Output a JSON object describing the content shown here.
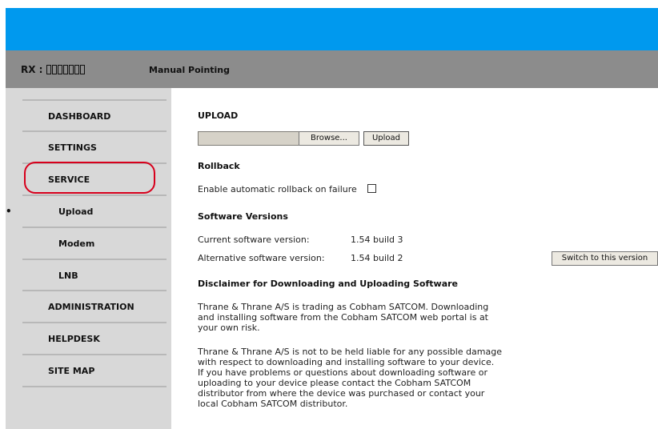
{
  "header": {
    "rx_label": "RX :",
    "rx_value_count": 7,
    "mode": "Manual Pointing"
  },
  "sidebar": {
    "items": [
      {
        "label": "DASHBOARD"
      },
      {
        "label": "SETTINGS"
      },
      {
        "label": "SERVICE"
      },
      {
        "label": "Upload",
        "selected": true
      },
      {
        "label": "Modem"
      },
      {
        "label": "LNB"
      },
      {
        "label": "ADMINISTRATION"
      },
      {
        "label": "HELPDESK"
      },
      {
        "label": "SITE MAP"
      }
    ],
    "bullet": "•"
  },
  "upload": {
    "heading": "UPLOAD",
    "browse_label": "Browse...",
    "upload_label": "Upload"
  },
  "rollback": {
    "heading": "Rollback",
    "checkbox_label": "Enable automatic rollback on failure",
    "checked": false
  },
  "versions": {
    "heading": "Software Versions",
    "current_label": "Current software version:",
    "current_value": "1.54 build 3",
    "alt_label": "Alternative software version:",
    "alt_value": "1.54 build 2",
    "switch_label": "Switch to this version"
  },
  "disclaimer": {
    "heading": "Disclaimer for Downloading and Uploading Software",
    "para1_lines": [
      "Thrane & Thrane A/S is trading as Cobham SATCOM. Downloading",
      "and installing software from the Cobham SATCOM web portal is at",
      "your own risk."
    ],
    "para2_lines": [
      "Thrane & Thrane A/S is not to be held liable for any possible damage",
      "with respect to downloading and installing software to your device.",
      "If you have problems or questions about downloading software or",
      "uploading to your device please contact the Cobham SATCOM",
      "distributor from where the device was purchased or contact your",
      "local Cobham SATCOM distributor."
    ]
  }
}
